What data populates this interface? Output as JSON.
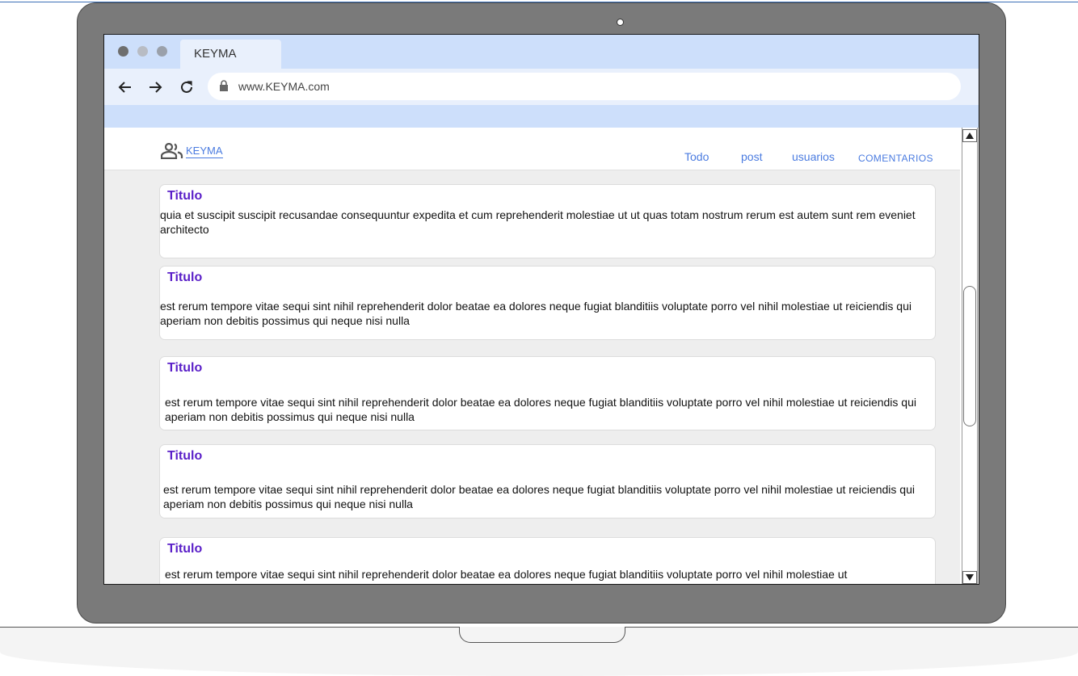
{
  "browser": {
    "tab_title": "KEYMA",
    "url": "www.KEYMA.com"
  },
  "app": {
    "brand": "KEYMA",
    "nav": [
      "Todo",
      "post",
      "usuarios",
      "COMENTARIOS"
    ]
  },
  "posts": [
    {
      "title": "Titulo",
      "body": "quia et suscipit suscipit recusandae consequuntur expedita et cum reprehenderit molestiae ut ut quas totam nostrum rerum est autem sunt rem eveniet architecto"
    },
    {
      "title": "Titulo",
      "body": "est rerum tempore vitae sequi sint nihil reprehenderit dolor beatae ea dolores neque fugiat blanditiis voluptate porro vel nihil molestiae ut reiciendis qui aperiam non debitis possimus qui neque nisi nulla"
    },
    {
      "title": "Titulo",
      "body": "est rerum tempore vitae sequi sint nihil reprehenderit dolor beatae ea dolores neque fugiat blanditiis voluptate porro vel nihil molestiae ut reiciendis qui aperiam non debitis possimus qui neque nisi nulla"
    },
    {
      "title": "Titulo",
      "body": "est rerum tempore vitae sequi sint nihil reprehenderit dolor beatae ea dolores neque fugiat blanditiis voluptate porro vel nihil molestiae ut reiciendis qui aperiam non debitis possimus qui neque nisi nulla"
    },
    {
      "title": "Titulo",
      "body": "est rerum tempore vitae sequi sint nihil reprehenderit dolor beatae ea dolores neque fugiat blanditiis voluptate porro vel nihil molestiae ut"
    }
  ],
  "colors": {
    "link": "#4a7be0",
    "title": "#5a1fc8",
    "chrome": "#cddffb"
  },
  "icons": [
    "back-arrow-icon",
    "forward-arrow-icon",
    "reload-icon",
    "lock-icon",
    "people-icon",
    "scroll-up-icon",
    "scroll-down-icon"
  ]
}
